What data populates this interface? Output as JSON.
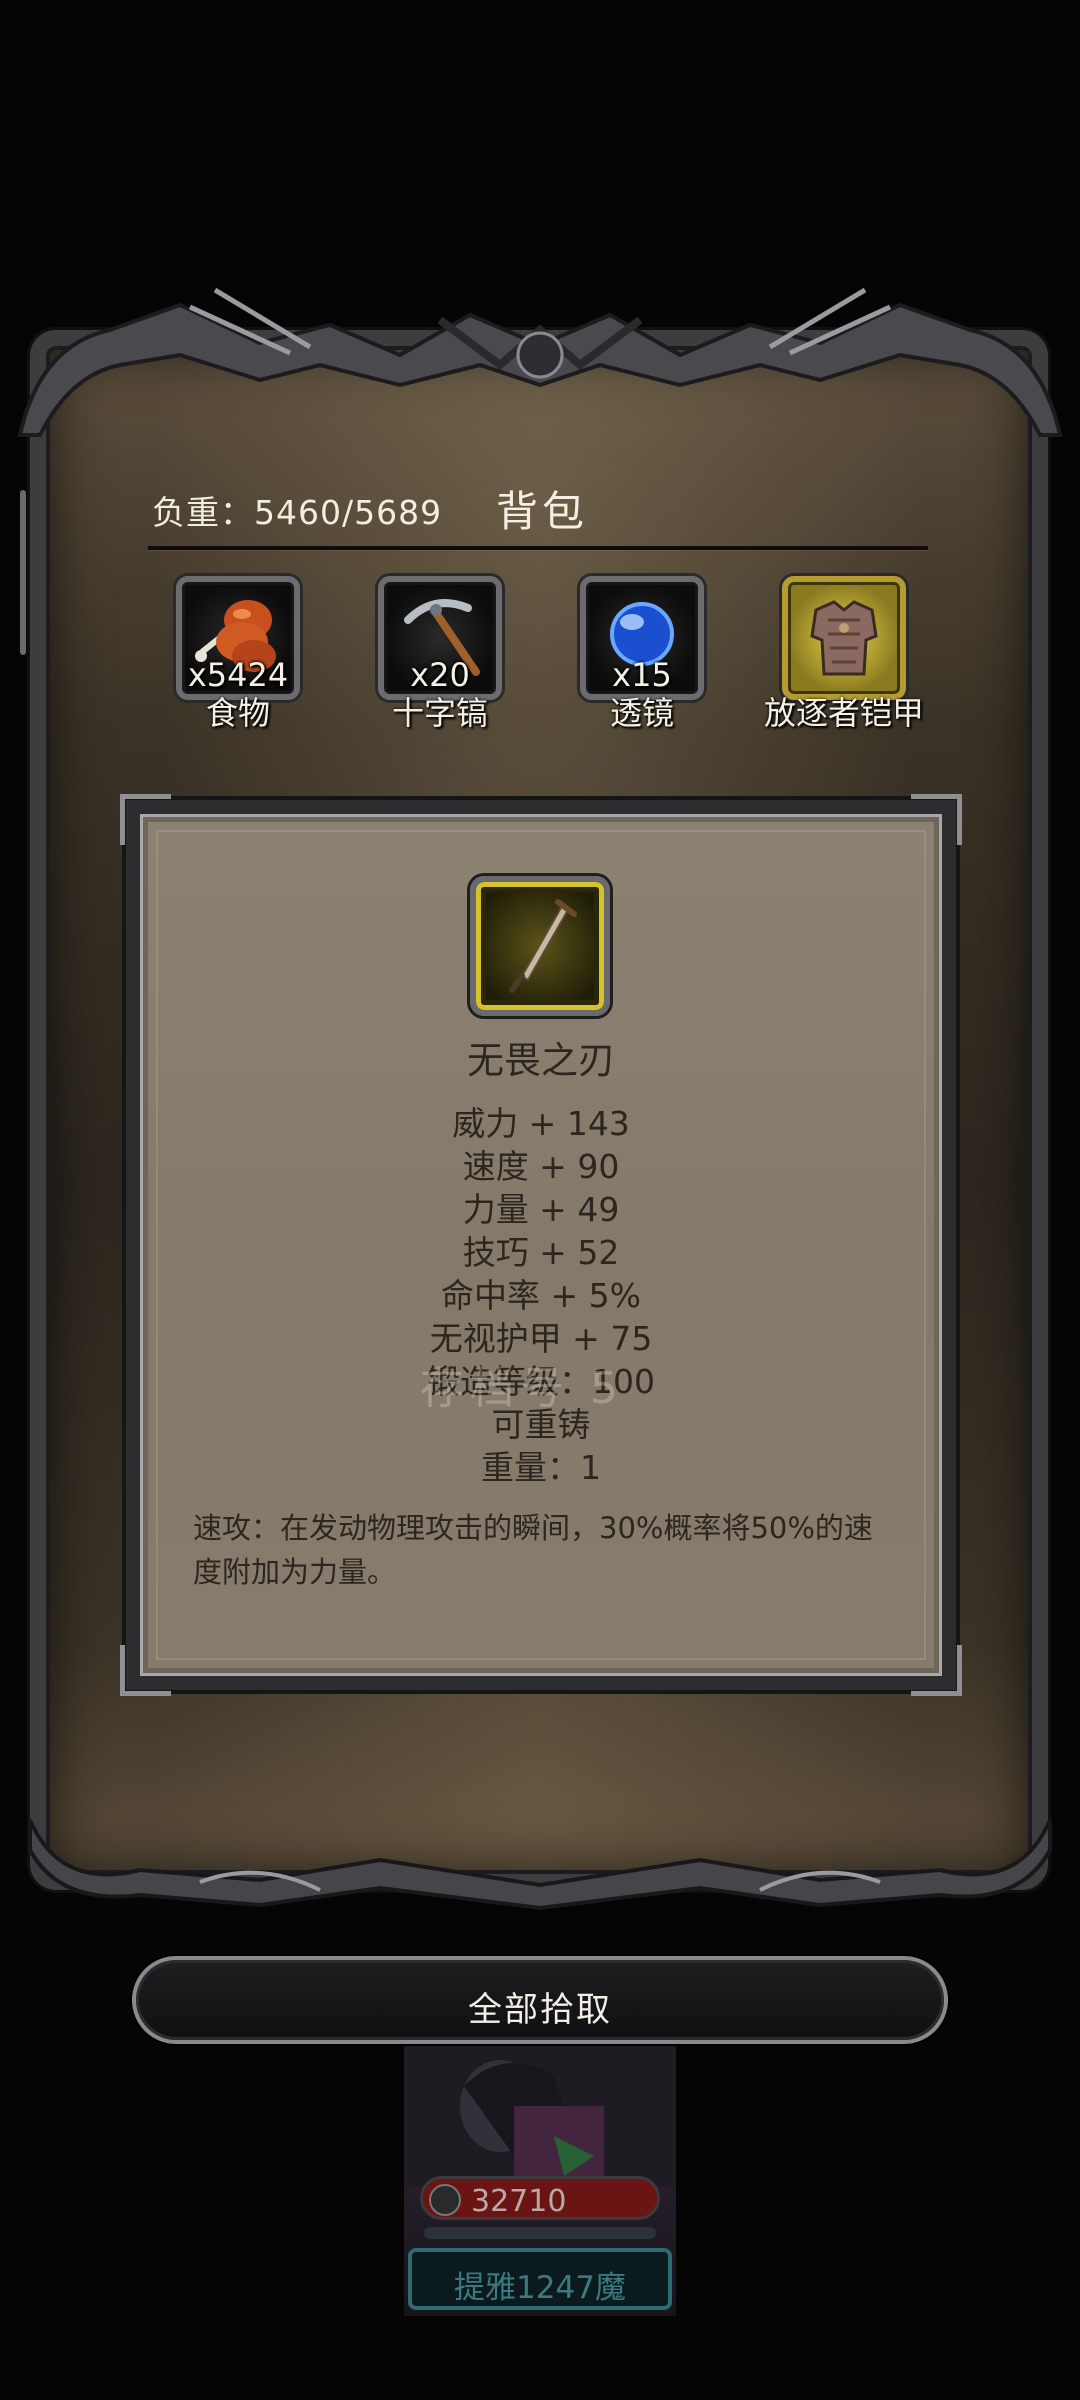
{
  "backpack": {
    "title": "背包",
    "weight_label": "负重：",
    "weight_value": "5460/5689"
  },
  "items": [
    {
      "name": "食物",
      "count": "x5424",
      "icon": "food-icon"
    },
    {
      "name": "十字镐",
      "count": "x20",
      "icon": "pickaxe-icon"
    },
    {
      "name": "透镜",
      "count": "x15",
      "icon": "lens-icon"
    },
    {
      "name": "放逐者铠甲",
      "count": "",
      "icon": "armor-icon"
    }
  ],
  "detail": {
    "icon": "dagger-icon",
    "name": "无畏之刃",
    "stats": [
      "威力 + 143",
      "速度 + 90",
      "力量 + 49",
      "技巧 + 52",
      "命中率 + 5%",
      "无视护甲 + 75",
      "锻造等级：100",
      "可重铸",
      "重量：1"
    ],
    "description": "速攻：在发动物理攻击的瞬间，30%概率将50%的速度附加为力量。",
    "watermark": "存档号 5"
  },
  "pickup_button": {
    "label": "全部拾取"
  },
  "background_character": {
    "hp_value": "32710",
    "name": "提雅1247魔"
  },
  "colors": {
    "panel": "#877c6c",
    "frame": "#3a3226",
    "gold_slot": "#d6c22a",
    "hp_bar": "#6b1414",
    "name_box": "#2f6a72"
  }
}
